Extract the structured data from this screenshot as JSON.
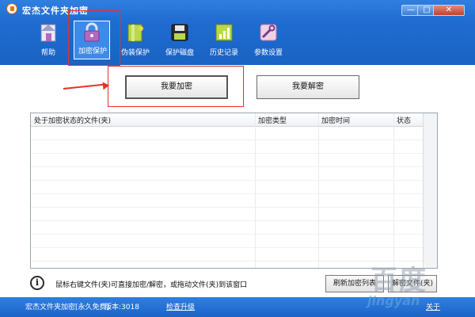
{
  "window": {
    "title": "宏杰文件夹加密",
    "min": "—",
    "max": "□",
    "close": "✕"
  },
  "toolbar": {
    "items": [
      {
        "label": "帮助",
        "icon": "home-icon"
      },
      {
        "label": "加密保护",
        "icon": "lock-icon"
      },
      {
        "label": "伪装保护",
        "icon": "disguise-icon"
      },
      {
        "label": "保护磁盘",
        "icon": "disk-icon"
      },
      {
        "label": "历史记录",
        "icon": "history-icon"
      },
      {
        "label": "参数设置",
        "icon": "tools-icon"
      }
    ],
    "active": "加密保护"
  },
  "actions": {
    "encrypt": "我要加密",
    "decrypt": "我要解密"
  },
  "table": {
    "columns": [
      "处于加密状态的文件(夹)",
      "加密类型",
      "加密时间",
      "状态"
    ],
    "rows": []
  },
  "hint": "鼠标右键文件(夹)可直接加密/解密，或拖动文件(夹)到该窗口",
  "buttons": {
    "refresh": "刷新加密列表",
    "decrypt_file": "解密文件(夹)"
  },
  "statusbar": {
    "product": "宏杰文件夹加密[永久免费]",
    "version": "版本:3018",
    "upgrade": "检查升级",
    "about": "关于"
  },
  "watermark": {
    "main": "百度",
    "sub": "jingyan"
  },
  "colors": {
    "titlebar": "#1f6bd0",
    "highlight": "#e8302a"
  }
}
